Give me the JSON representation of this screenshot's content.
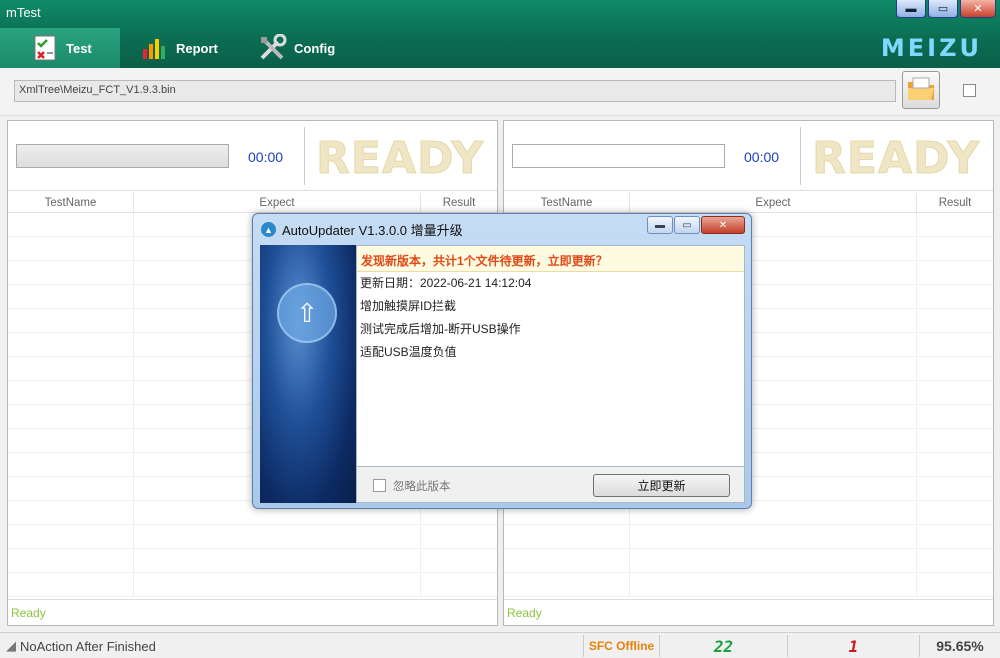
{
  "app": {
    "title": "mTest",
    "brand": "MEIZU"
  },
  "window_controls": {
    "minimize": "▬",
    "maximize": "▭",
    "close": "✕"
  },
  "tabs": [
    {
      "label": "Test",
      "icon": "checklist-icon",
      "active": true
    },
    {
      "label": "Report",
      "icon": "bar-chart-icon",
      "active": false
    },
    {
      "label": "Config",
      "icon": "tools-icon",
      "active": false
    }
  ],
  "path": {
    "value": "XmlTree\\Meizu_FCT_V1.9.3.bin"
  },
  "panels": [
    {
      "timer": "00:00",
      "state": "READY",
      "columns": [
        "TestName",
        "Expect",
        "Result"
      ],
      "status": "Ready"
    },
    {
      "timer": "00:00",
      "state": "READY",
      "columns": [
        "TestName",
        "Expect",
        "Result"
      ],
      "status": "Ready"
    }
  ],
  "statusbar": {
    "action": "NoAction After Finished",
    "sfc": "SFC Offline",
    "count_pass": "22",
    "count_fail": "1",
    "rate": "95.65%"
  },
  "dialog": {
    "title": "AutoUpdater V1.3.0.0 增量升级",
    "notice": "发现新版本，共计1个文件待更新，立即更新？",
    "lines": [
      "更新日期：2022-06-21 14:12:04",
      "增加触摸屏ID拦截",
      "测试完成后增加-断开USB操作",
      "适配USB温度负值"
    ],
    "ignore_label": "忽略此版本",
    "update_button": "立即更新"
  },
  "colors": {
    "header": "#0b6e53",
    "timer": "#1c3fc6",
    "sfc": "#e7820b",
    "pass": "#17a03b",
    "fail": "#d0161d",
    "notice": "#e04a18"
  }
}
